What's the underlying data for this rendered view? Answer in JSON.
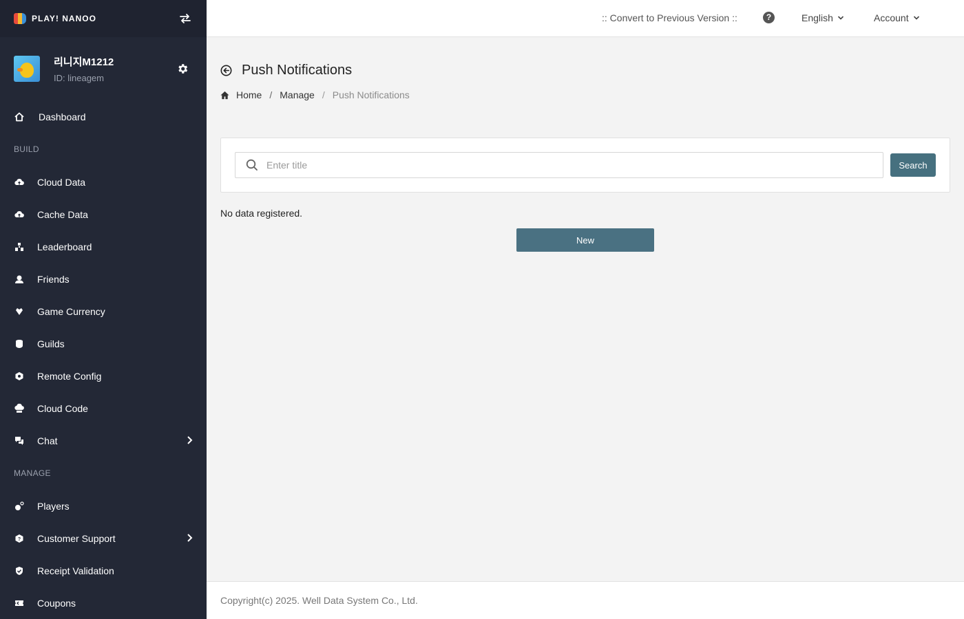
{
  "app": {
    "logo_text": "PLAY! NANOO",
    "logo_colors": [
      "#e84b3c",
      "#f5b82e",
      "#3a8fd6"
    ]
  },
  "profile": {
    "name": "리니지M1212",
    "id_text": "ID: lineagem"
  },
  "sidebar": {
    "dashboard": "Dashboard",
    "build_label": "BUILD",
    "build_items": [
      {
        "label": "Cloud Data",
        "icon": "cloud-data-icon"
      },
      {
        "label": "Cache Data",
        "icon": "cache-data-icon"
      },
      {
        "label": "Leaderboard",
        "icon": "leaderboard-icon"
      },
      {
        "label": "Friends",
        "icon": "friends-icon"
      },
      {
        "label": "Game Currency",
        "icon": "game-currency-icon"
      },
      {
        "label": "Guilds",
        "icon": "guilds-icon"
      },
      {
        "label": "Remote Config",
        "icon": "remote-config-icon"
      },
      {
        "label": "Cloud Code",
        "icon": "cloud-code-icon"
      },
      {
        "label": "Chat",
        "icon": "chat-icon"
      }
    ],
    "manage_label": "MANAGE",
    "manage_items": [
      {
        "label": "Players",
        "icon": "players-icon"
      },
      {
        "label": "Customer Support",
        "icon": "customer-support-icon"
      },
      {
        "label": "Receipt Validation",
        "icon": "receipt-validation-icon"
      },
      {
        "label": "Coupons",
        "icon": "coupons-icon"
      }
    ]
  },
  "topbar": {
    "convert": ":: Convert to Previous Version ::",
    "help": "?",
    "language": "English",
    "account": "Account"
  },
  "page": {
    "title": "Push Notifications",
    "breadcrumb": [
      "Home",
      "Manage",
      "Push Notifications"
    ]
  },
  "search": {
    "placeholder": "Enter title",
    "value": "",
    "button": "Search"
  },
  "empty_text": "No data registered.",
  "new_button": "New",
  "footer": "Copyright(c) 2025. Well Data System Co., Ltd.",
  "colors": {
    "sidebar_bg": "#232836",
    "accent_button": "#46707f"
  }
}
